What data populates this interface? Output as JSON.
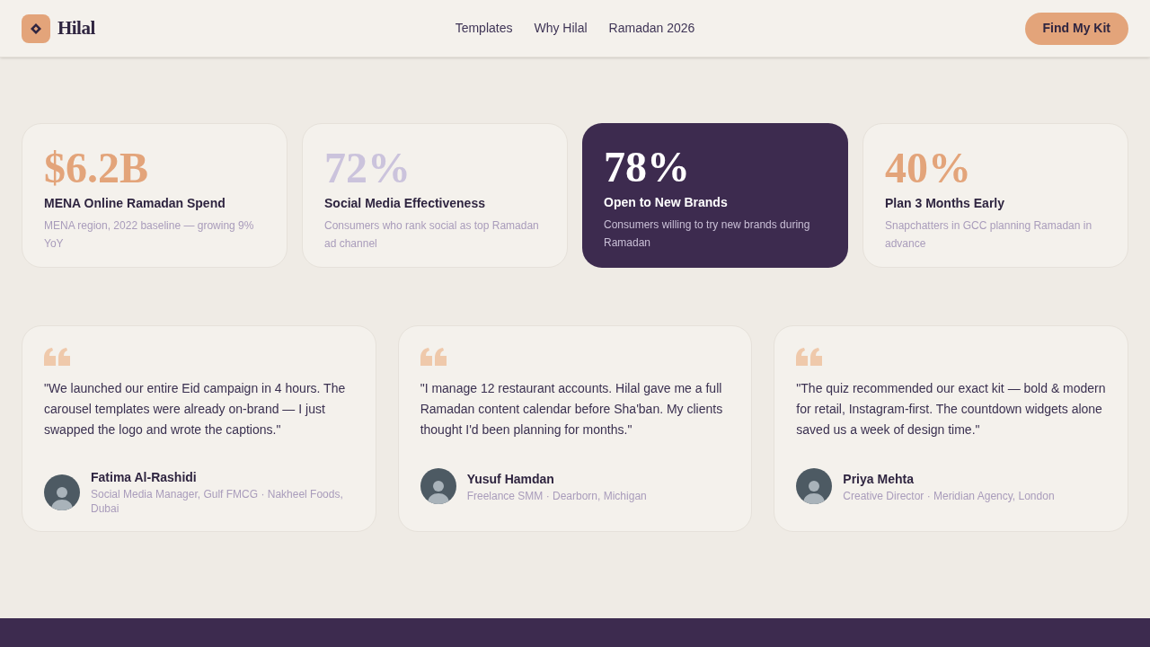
{
  "header": {
    "brand": "Hilal",
    "nav": [
      "Templates",
      "Why Hilal",
      "Ramadan 2026"
    ],
    "cta": "Find My Kit"
  },
  "stats": [
    {
      "value": "$6.2B",
      "title": "MENA Online Ramadan Spend",
      "note": "MENA region, 2022 baseline — growing 9% YoY",
      "highlighted": false,
      "color": "#e3a47a"
    },
    {
      "value": "72%",
      "title": "Social Media Effectiveness",
      "note": "Consumers who rank social as top Ramadan ad channel",
      "highlighted": false,
      "color": "#cbc3dc"
    },
    {
      "value": "78%",
      "title": "Open to New Brands",
      "note": "Consumers willing to try new brands during Ramadan",
      "highlighted": true,
      "color": "#ffffff"
    },
    {
      "value": "40%",
      "title": "Plan 3 Months Early",
      "note": "Snapchatters in GCC planning Ramadan in advance",
      "highlighted": false,
      "color": "#e3a47a"
    }
  ],
  "testimonials": [
    {
      "quote": "\"We launched our entire Eid campaign in 4 hours. The carousel templates were already on-brand — I just swapped the logo and wrote the captions.\"",
      "name": "Fatima Al-Rashidi",
      "role": "Social Media Manager, Gulf FMCG · Nakheel Foods, Dubai"
    },
    {
      "quote": "\"I manage 12 restaurant accounts. Hilal gave me a full Ramadan content calendar before Sha'ban. My clients thought I'd been planning for months.\"",
      "name": "Yusuf Hamdan",
      "role": "Freelance SMM · Dearborn, Michigan"
    },
    {
      "quote": "\"The quiz recommended our exact kit — bold & modern for retail, Instagram-first. The countdown widgets alone saved us a week of design time.\"",
      "name": "Priya Mehta",
      "role": "Creative Director · Meridian Agency, London"
    }
  ]
}
